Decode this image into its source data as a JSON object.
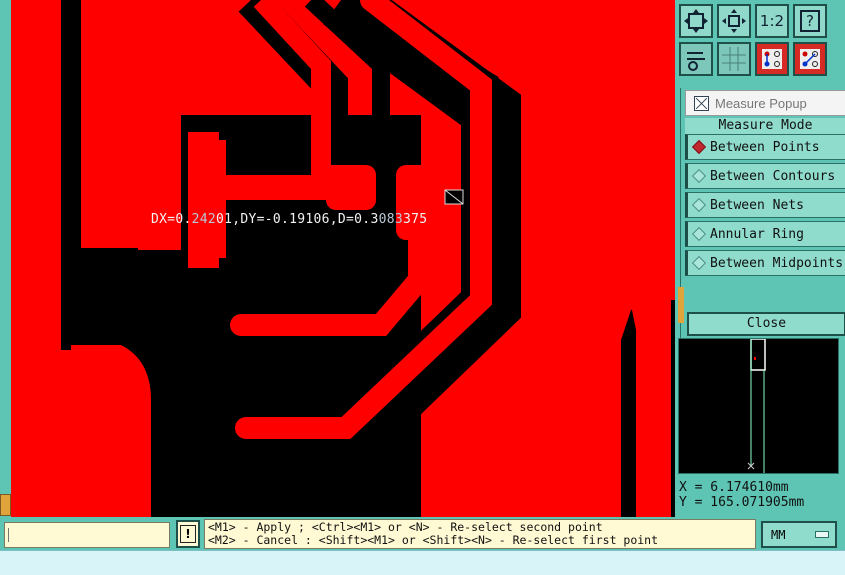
{
  "canvas": {
    "measure_readout_parts": [
      "DX=0.",
      "242",
      "01,DY=-0.19106,D=0.3",
      "083",
      "375"
    ],
    "colors": {
      "copper": "#ff0000",
      "background": "#000000",
      "trace_outline": "#000000"
    }
  },
  "toolbar": {
    "buttons": [
      {
        "name": "zoom-fit-icon",
        "label": ""
      },
      {
        "name": "zoom-center-icon",
        "label": ""
      },
      {
        "name": "zoom-1to1-button",
        "label": "1:2"
      },
      {
        "name": "help-icon",
        "label": "?"
      },
      {
        "name": "display-options-icon",
        "label": ""
      },
      {
        "name": "grid-icon",
        "label": ""
      },
      {
        "name": "layer-toggle-icon",
        "label": ""
      },
      {
        "name": "layer-toggle-alt-icon",
        "label": ""
      }
    ]
  },
  "measure_popup": {
    "title": "Measure Popup",
    "mode_label": "Measure Mode",
    "options": [
      {
        "label": "Between Points",
        "selected": true
      },
      {
        "label": "Between Contours",
        "selected": false
      },
      {
        "label": "Between Nets",
        "selected": false
      },
      {
        "label": "Annular Ring",
        "selected": false
      },
      {
        "label": "Between Midpoints",
        "selected": false
      }
    ],
    "close_label": "Close"
  },
  "coordinates": {
    "x": "X = 6.174610mm",
    "y": "Y = 165.071905mm"
  },
  "status": {
    "warning_label": "!",
    "prompt_line1": "<M1> - Apply  ; <Ctrl><M1> or <N> - Re-select second point",
    "prompt_line2": "<M2> - Cancel : <Shift><M1> or <Shift><N> - Re-select first point",
    "units": "MM"
  }
}
